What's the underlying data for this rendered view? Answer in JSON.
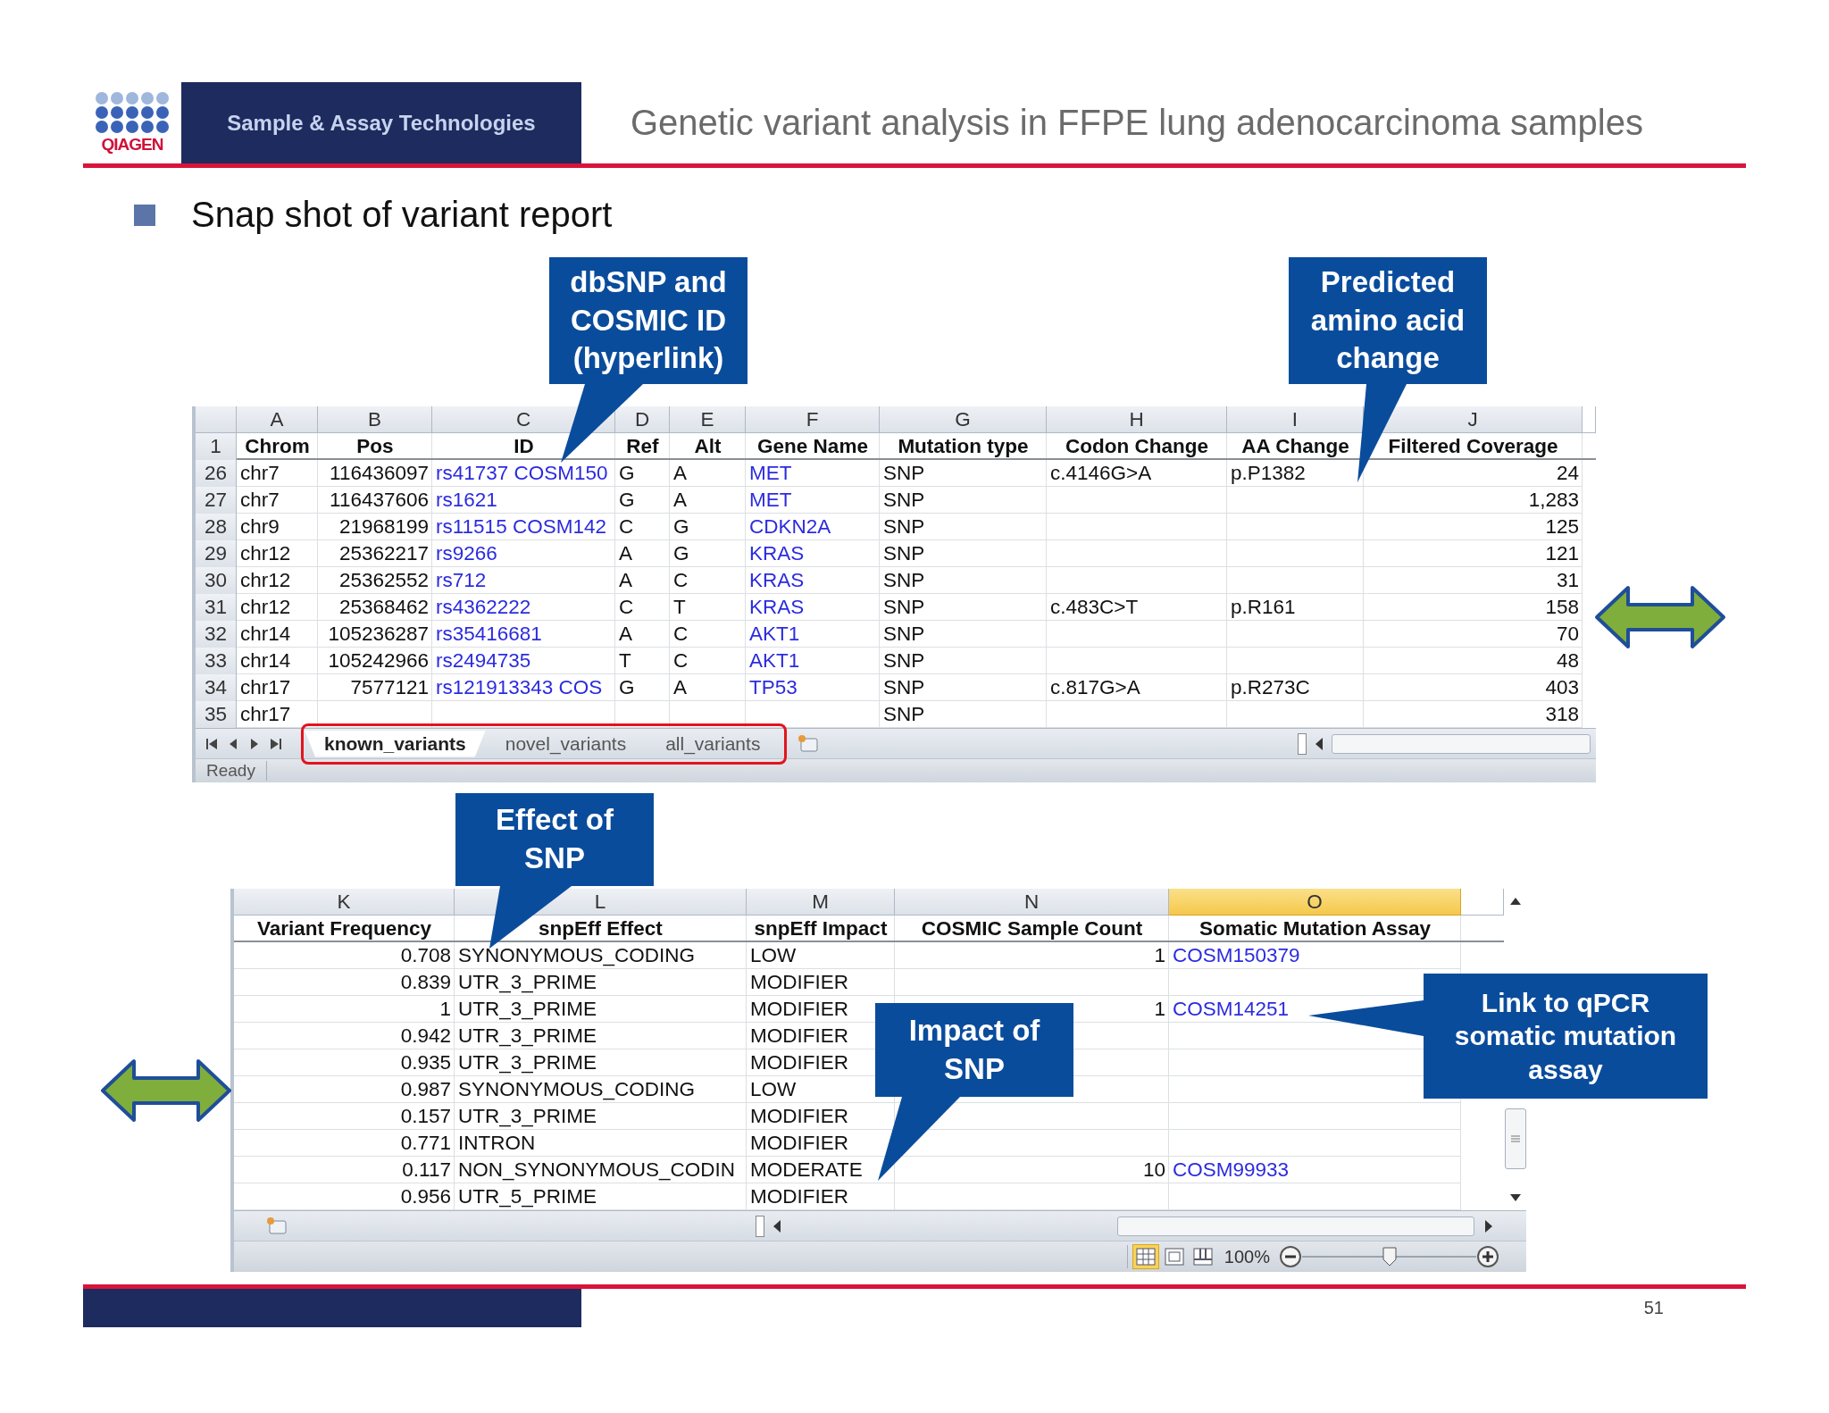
{
  "header": {
    "brand": "QIAGEN",
    "tagline": "Sample & Assay Technologies",
    "title": "Genetic variant analysis in FFPE lung adenocarcinoma samples"
  },
  "bullets": [
    "Snap shot of variant report"
  ],
  "top_sheet": {
    "header_row_number": "1",
    "columns": [
      {
        "letter": "A",
        "heading": "Chrom",
        "kind": "text"
      },
      {
        "letter": "B",
        "heading": "Pos",
        "kind": "number"
      },
      {
        "letter": "C",
        "heading": "ID",
        "kind": "link"
      },
      {
        "letter": "D",
        "heading": "Ref",
        "kind": "text"
      },
      {
        "letter": "E",
        "heading": "Alt",
        "kind": "text"
      },
      {
        "letter": "F",
        "heading": "Gene Name",
        "kind": "link"
      },
      {
        "letter": "G",
        "heading": "Mutation type",
        "kind": "text"
      },
      {
        "letter": "H",
        "heading": "Codon Change",
        "kind": "text"
      },
      {
        "letter": "I",
        "heading": "AA Change",
        "kind": "text"
      },
      {
        "letter": "J",
        "heading": "Filtered Coverage",
        "kind": "number"
      }
    ],
    "rows": [
      {
        "row_number": "26",
        "cells": {
          "A": "chr7",
          "B": "116436097",
          "C": "rs41737 COSM150",
          "D": "G",
          "E": "A",
          "F": "MET",
          "G": "SNP",
          "H": "c.4146G>A",
          "I": "p.P1382",
          "J": "24"
        }
      },
      {
        "row_number": "27",
        "cells": {
          "A": "chr7",
          "B": "116437606",
          "C": "rs1621",
          "D": "G",
          "E": "A",
          "F": "MET",
          "G": "SNP",
          "J": "1,283"
        }
      },
      {
        "row_number": "28",
        "cells": {
          "A": "chr9",
          "B": "21968199",
          "C": "rs11515 COSM142",
          "D": "C",
          "E": "G",
          "F": "CDKN2A",
          "G": "SNP",
          "J": "125"
        }
      },
      {
        "row_number": "29",
        "cells": {
          "A": "chr12",
          "B": "25362217",
          "C": "rs9266",
          "D": "A",
          "E": "G",
          "F": "KRAS",
          "G": "SNP",
          "J": "121"
        }
      },
      {
        "row_number": "30",
        "cells": {
          "A": "chr12",
          "B": "25362552",
          "C": "rs712",
          "D": "A",
          "E": "C",
          "F": "KRAS",
          "G": "SNP",
          "J": "31"
        }
      },
      {
        "row_number": "31",
        "cells": {
          "A": "chr12",
          "B": "25368462",
          "C": "rs4362222",
          "D": "C",
          "E": "T",
          "F": "KRAS",
          "G": "SNP",
          "H": "c.483C>T",
          "I": "p.R161",
          "J": "158"
        }
      },
      {
        "row_number": "32",
        "cells": {
          "A": "chr14",
          "B": "105236287",
          "C": "rs35416681",
          "D": "A",
          "E": "C",
          "F": "AKT1",
          "G": "SNP",
          "J": "70"
        }
      },
      {
        "row_number": "33",
        "cells": {
          "A": "chr14",
          "B": "105242966",
          "C": "rs2494735",
          "D": "T",
          "E": "C",
          "F": "AKT1",
          "G": "SNP",
          "J": "48"
        }
      },
      {
        "row_number": "34",
        "cells": {
          "A": "chr17",
          "B": "7577121",
          "C": "rs121913343 COS",
          "D": "G",
          "E": "A",
          "F": "TP53",
          "G": "SNP",
          "H": "c.817G>A",
          "I": "p.R273C",
          "J": "403"
        }
      },
      {
        "row_number": "35",
        "cells": {
          "A": "chr17",
          "G": "SNP",
          "J": "318"
        }
      }
    ],
    "tabs": [
      {
        "label": "known_variants",
        "selected": true
      },
      {
        "label": "novel_variants",
        "selected": false
      },
      {
        "label": "all_variants",
        "selected": false
      }
    ],
    "status": "Ready"
  },
  "bottom_sheet": {
    "columns": [
      {
        "letter": "K",
        "heading": "Variant Frequency",
        "kind": "number",
        "selected": false
      },
      {
        "letter": "L",
        "heading": "snpEff Effect",
        "kind": "text",
        "selected": false
      },
      {
        "letter": "M",
        "heading": "snpEff Impact",
        "kind": "text",
        "selected": false
      },
      {
        "letter": "N",
        "heading": "COSMIC Sample Count",
        "kind": "number",
        "selected": false
      },
      {
        "letter": "O",
        "heading": "Somatic Mutation Assay",
        "kind": "link",
        "selected": true
      }
    ],
    "rows": [
      {
        "cells": {
          "K": "0.708",
          "L": "SYNONYMOUS_CODING",
          "M": "LOW",
          "N": "1",
          "O": "COSM150379"
        }
      },
      {
        "cells": {
          "K": "0.839",
          "L": "UTR_3_PRIME",
          "M": "MODIFIER"
        }
      },
      {
        "cells": {
          "K": "1",
          "L": "UTR_3_PRIME",
          "M": "MODIFIER",
          "N": "1",
          "O": "COSM14251"
        }
      },
      {
        "cells": {
          "K": "0.942",
          "L": "UTR_3_PRIME",
          "M": "MODIFIER"
        }
      },
      {
        "cells": {
          "K": "0.935",
          "L": "UTR_3_PRIME",
          "M": "MODIFIER"
        }
      },
      {
        "cells": {
          "K": "0.987",
          "L": "SYNONYMOUS_CODING",
          "M": "LOW"
        }
      },
      {
        "cells": {
          "K": "0.157",
          "L": "UTR_3_PRIME",
          "M": "MODIFIER"
        }
      },
      {
        "cells": {
          "K": "0.771",
          "L": "INTRON",
          "M": "MODIFIER"
        }
      },
      {
        "cells": {
          "K": "0.117",
          "L": "NON_SYNONYMOUS_CODIN",
          "M": "MODERATE",
          "N": "10",
          "O": "COSM99933"
        }
      },
      {
        "cells": {
          "K": "0.956",
          "L": "UTR_5_PRIME",
          "M": "MODIFIER"
        }
      }
    ],
    "view_buttons": [
      {
        "kind": "normal",
        "selected": true
      },
      {
        "kind": "page_layout",
        "selected": false
      },
      {
        "kind": "page_break",
        "selected": false
      }
    ],
    "zoom": {
      "label": "100%",
      "level": 0.5
    }
  },
  "callouts": [
    {
      "lines": [
        "dbSNP and",
        "COSMIC ID",
        "(hyperlink)"
      ]
    },
    {
      "lines": [
        "Predicted",
        "amino acid",
        "change"
      ]
    },
    {
      "lines": [
        "Effect of",
        "SNP"
      ]
    },
    {
      "lines": [
        "Impact of",
        "SNP"
      ]
    },
    {
      "lines": [
        "Link to qPCR",
        "somatic mutation",
        "assay"
      ]
    }
  ],
  "footer": {
    "page_number": "51"
  }
}
